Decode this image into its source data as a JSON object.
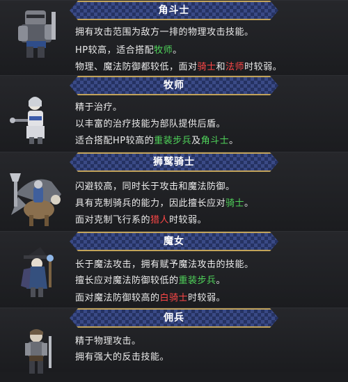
{
  "colors": {
    "red": "#ff4747",
    "green": "#4fd35a",
    "text": "#ececec"
  },
  "units": [
    {
      "name": "角斗士",
      "icon": "gladiator-sprite",
      "lines": [
        [
          {
            "t": "拥有攻击范围为敌方一排的物理攻击技能。"
          }
        ],
        [
          {
            "t": "HP较高，适合搭配"
          },
          {
            "t": "牧师",
            "c": "green"
          },
          {
            "t": "。"
          }
        ],
        [
          {
            "t": "物理、魔法防御都较低，面对"
          },
          {
            "t": "骑士",
            "c": "red"
          },
          {
            "t": "和"
          },
          {
            "t": "法师",
            "c": "red"
          },
          {
            "t": "时较弱。"
          }
        ]
      ]
    },
    {
      "name": "牧师",
      "icon": "priest-sprite",
      "lines": [
        [
          {
            "t": "精于治疗。"
          }
        ],
        [
          {
            "t": "以丰富的治疗技能为部队提供后盾。"
          }
        ],
        [
          {
            "t": "适合搭配HP较高的"
          },
          {
            "t": "重装步兵",
            "c": "green"
          },
          {
            "t": "及"
          },
          {
            "t": "角斗士",
            "c": "green"
          },
          {
            "t": "。"
          }
        ]
      ]
    },
    {
      "name": "狮鹫骑士",
      "icon": "gryphon-knight-sprite",
      "lines": [
        [
          {
            "t": "闪避较高，同时长于攻击和魔法防御。"
          }
        ],
        [
          {
            "t": "具有克制骑兵的能力，因此擅长应对"
          },
          {
            "t": "骑士",
            "c": "green"
          },
          {
            "t": "。"
          }
        ],
        [
          {
            "t": "面对克制飞行系的"
          },
          {
            "t": "猎人",
            "c": "red"
          },
          {
            "t": "时较弱。"
          }
        ]
      ]
    },
    {
      "name": "魔女",
      "icon": "witch-sprite",
      "lines": [
        [
          {
            "t": "长于魔法攻击，拥有赋予魔法攻击的技能。"
          }
        ],
        [
          {
            "t": "擅长应对魔法防御较低的"
          },
          {
            "t": "重装步兵",
            "c": "green"
          },
          {
            "t": "。"
          }
        ],
        [
          {
            "t": "面对魔法防御较高的"
          },
          {
            "t": "白骑士",
            "c": "red"
          },
          {
            "t": "时较弱。"
          }
        ]
      ]
    },
    {
      "name": "佣兵",
      "icon": "mercenary-sprite",
      "lines": [
        [
          {
            "t": "精于物理攻击。"
          }
        ],
        [
          {
            "t": "拥有强大的反击技能。"
          }
        ]
      ]
    }
  ]
}
